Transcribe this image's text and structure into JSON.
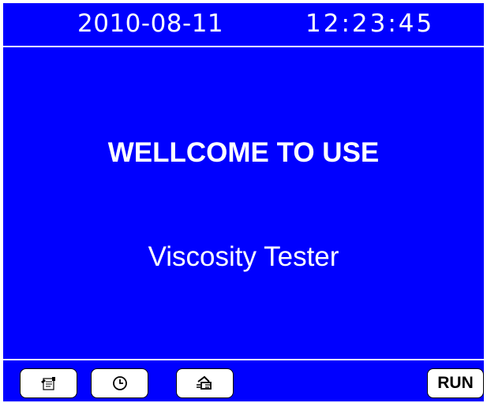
{
  "status_bar": {
    "date": "2010-08-11",
    "time": "12:23:45"
  },
  "main": {
    "welcome_text": "WELLCOME TO USE",
    "product_name": "Viscosity Tester"
  },
  "toolbar": {
    "settings_icon": "settings-document-icon",
    "clock_icon": "clock-icon",
    "adjust_icon": "tool-adjust-icon",
    "run_label": "RUN"
  },
  "colors": {
    "background": "#0000ff",
    "text": "#ffffff",
    "button": "#ffffff"
  }
}
